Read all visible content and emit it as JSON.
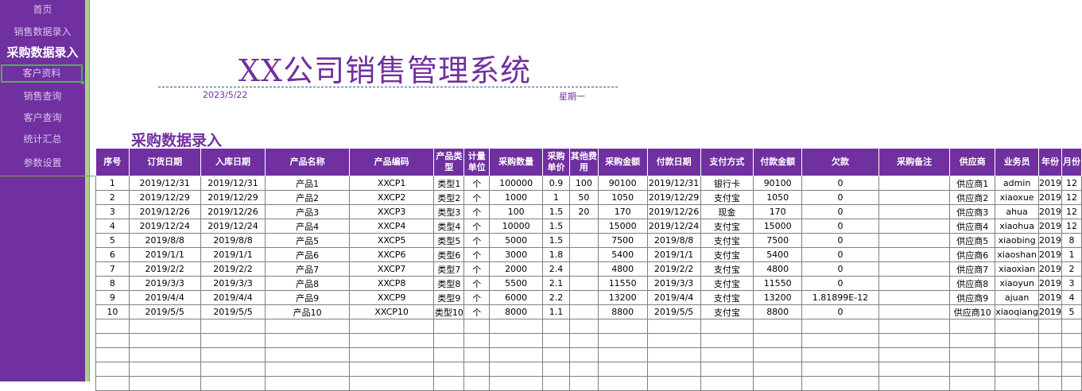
{
  "sidebar": {
    "items": [
      {
        "label": "首页"
      },
      {
        "label": "销售数据录入"
      },
      {
        "label": "采购数据录入"
      },
      {
        "label": "客户资料"
      },
      {
        "label": "销售查询"
      },
      {
        "label": "客户查询"
      },
      {
        "label": "统计汇总"
      },
      {
        "label": "参数设置"
      }
    ],
    "active_index": 2,
    "selected_index": 3
  },
  "header": {
    "title": "XX公司销售管理系统",
    "date": "2023/5/22",
    "weekday": "星期一"
  },
  "section_title": "采购数据录入",
  "table": {
    "columns": [
      "序号",
      "订货日期",
      "入库日期",
      "产品名称",
      "产品编码",
      "产品类型",
      "计量单位",
      "采购数量",
      "采购单价",
      "其他费用",
      "采购金额",
      "付款日期",
      "支付方式",
      "付款金额",
      "欠款",
      "采购备注",
      "供应商",
      "业务员",
      "年份",
      "月份"
    ],
    "rows": [
      [
        "1",
        "2019/12/31",
        "2019/12/31",
        "产品1",
        "XXCP1",
        "类型1",
        "个",
        "100000",
        "0.9",
        "100",
        "90100",
        "2019/12/31",
        "银行卡",
        "90100",
        "0",
        "",
        "供应商1",
        "admin",
        "2019",
        "12"
      ],
      [
        "2",
        "2019/12/29",
        "2019/12/29",
        "产品2",
        "XXCP2",
        "类型2",
        "个",
        "1000",
        "1",
        "50",
        "1050",
        "2019/12/29",
        "支付宝",
        "1050",
        "0",
        "",
        "供应商2",
        "xiaoxue",
        "2019",
        "12"
      ],
      [
        "3",
        "2019/12/26",
        "2019/12/26",
        "产品3",
        "XXCP3",
        "类型3",
        "个",
        "100",
        "1.5",
        "20",
        "170",
        "2019/12/26",
        "现金",
        "170",
        "0",
        "",
        "供应商3",
        "ahua",
        "2019",
        "12"
      ],
      [
        "4",
        "2019/12/24",
        "2019/12/24",
        "产品4",
        "XXCP4",
        "类型4",
        "个",
        "10000",
        "1.5",
        "",
        "15000",
        "2019/12/24",
        "支付宝",
        "15000",
        "0",
        "",
        "供应商4",
        "xiaohua",
        "2019",
        "12"
      ],
      [
        "5",
        "2019/8/8",
        "2019/8/8",
        "产品5",
        "XXCP5",
        "类型5",
        "个",
        "5000",
        "1.5",
        "",
        "7500",
        "2019/8/8",
        "支付宝",
        "7500",
        "0",
        "",
        "供应商5",
        "xiaobing",
        "2019",
        "8"
      ],
      [
        "6",
        "2019/1/1",
        "2019/1/1",
        "产品6",
        "XXCP6",
        "类型6",
        "个",
        "3000",
        "1.8",
        "",
        "5400",
        "2019/1/1",
        "支付宝",
        "5400",
        "0",
        "",
        "供应商6",
        "xiaoshan",
        "2019",
        "1"
      ],
      [
        "7",
        "2019/2/2",
        "2019/2/2",
        "产品7",
        "XXCP7",
        "类型7",
        "个",
        "2000",
        "2.4",
        "",
        "4800",
        "2019/2/2",
        "支付宝",
        "4800",
        "0",
        "",
        "供应商7",
        "xiaoxian",
        "2019",
        "2"
      ],
      [
        "8",
        "2019/3/3",
        "2019/3/3",
        "产品8",
        "XXCP8",
        "类型8",
        "个",
        "5500",
        "2.1",
        "",
        "11550",
        "2019/3/3",
        "支付宝",
        "11550",
        "0",
        "",
        "供应商8",
        "xiaoyun",
        "2019",
        "3"
      ],
      [
        "9",
        "2019/4/4",
        "2019/4/4",
        "产品9",
        "XXCP9",
        "类型9",
        "个",
        "6000",
        "2.2",
        "",
        "13200",
        "2019/4/4",
        "支付宝",
        "13200",
        "1.81899E-12",
        "",
        "供应商9",
        "ajuan",
        "2019",
        "4"
      ],
      [
        "10",
        "2019/5/5",
        "2019/5/5",
        "产品10",
        "XXCP10",
        "类型10",
        "个",
        "8000",
        "1.1",
        "",
        "8800",
        "2019/5/5",
        "支付宝",
        "8800",
        "0",
        "",
        "供应商10",
        "xiaoqiang",
        "2019",
        "5"
      ]
    ]
  },
  "colors": {
    "accent": "#7030A0",
    "nav_text": "#D9C6EC",
    "selected_border": "#4CAF50"
  }
}
